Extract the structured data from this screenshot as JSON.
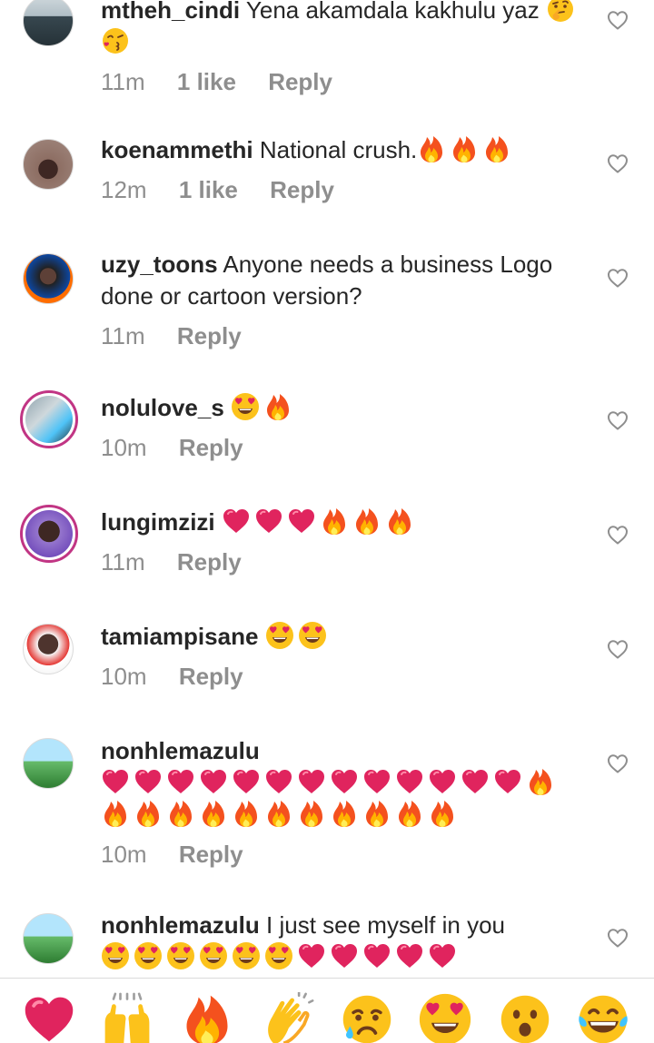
{
  "comments": [
    {
      "username": "mtheh_cindi",
      "text": "Yena akamdala kakhulu yaz",
      "time": "11m",
      "likes": "1 like",
      "reply": "Reply"
    },
    {
      "username": "koenammethi",
      "text": "National crush.",
      "time": "12m",
      "likes": "1 like",
      "reply": "Reply"
    },
    {
      "username": "uzy_toons",
      "text": "Anyone needs a business Logo done or cartoon version?",
      "time": "11m",
      "reply": "Reply"
    },
    {
      "username": "nolulove_s",
      "text": "",
      "time": "10m",
      "reply": "Reply"
    },
    {
      "username": "lungimzizi",
      "text": "",
      "time": "11m",
      "reply": "Reply"
    },
    {
      "username": "tamiampisane",
      "text": "",
      "time": "10m",
      "reply": "Reply"
    },
    {
      "username": "nonhlemazulu",
      "text": "",
      "time": "10m",
      "reply": "Reply"
    },
    {
      "username": "nonhlemazulu",
      "text": "I just see myself in you"
    }
  ],
  "icons": {
    "like": "heart-outline-icon",
    "reactions": [
      "red-heart",
      "raising-hands",
      "fire",
      "clapping-hands",
      "crying-face",
      "heart-eyes",
      "surprised-face",
      "tears-of-joy"
    ]
  },
  "colors": {
    "text": "#262626",
    "secondary": "#8e8e8e",
    "heart": "#e0245e",
    "story_ring": "#c13584"
  }
}
